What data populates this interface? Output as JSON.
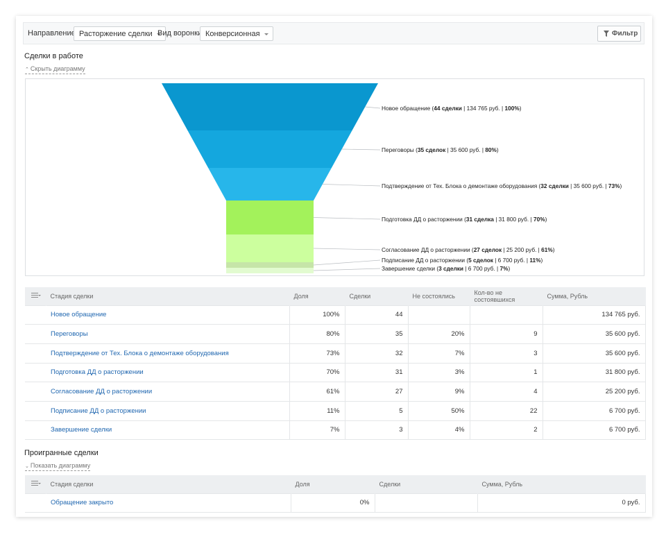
{
  "toolbar": {
    "direction_label": "Направление:",
    "direction_value": "Расторжение сделки",
    "funnel_label": "Вид воронки:",
    "funnel_value": "Конверсионная",
    "filter_label": "Фильтр"
  },
  "active": {
    "title": "Сделки в работе",
    "toggle": "Скрыть диаграмму"
  },
  "lost": {
    "title": "Проигранные сделки",
    "toggle": "Показать диаграмму"
  },
  "chart_data": {
    "type": "funnel",
    "title": "",
    "stages": [
      {
        "name": "Новое обращение",
        "deals": "44 сделки",
        "sum": "134 765 руб.",
        "percent": 100,
        "color": "#0a97cf"
      },
      {
        "name": "Переговоры",
        "deals": "35 сделок",
        "sum": "35 600 руб.",
        "percent": 80,
        "color": "#14a7de"
      },
      {
        "name": "Подтверждение от Тех. Блока о демонтаже оборудования",
        "deals": "32 сделки",
        "sum": "35 600 руб.",
        "percent": 73,
        "color": "#27b6ea"
      },
      {
        "name": "Подготовка ДД о расторжении",
        "deals": "31 сделка",
        "sum": "31 800 руб.",
        "percent": 70,
        "color": "#a3f25b"
      },
      {
        "name": "Согласование ДД о расторжении",
        "deals": "27 сделок",
        "sum": "25 200 руб.",
        "percent": 61,
        "color": "#ccff9e"
      },
      {
        "name": "Подписание ДД о расторжении",
        "deals": "5 сделок",
        "sum": "6 700 руб.",
        "percent": 11,
        "color": "#c6e5a8"
      },
      {
        "name": "Завершение сделки",
        "deals": "3 сделки",
        "sum": "6 700 руб.",
        "percent": 7,
        "color": "#e2fbd0"
      }
    ]
  },
  "table": {
    "headers": [
      "Стадия сделки",
      "Доля",
      "Сделки",
      "Не состоялись",
      "Кол-во не состоявшихся",
      "Сумма, Рубль"
    ],
    "rows": [
      {
        "stage": "Новое обращение",
        "share": "100%",
        "deals": "44",
        "failed": "",
        "failed_count": "",
        "sum": "134 765 руб."
      },
      {
        "stage": "Переговоры",
        "share": "80%",
        "deals": "35",
        "failed": "20%",
        "failed_count": "9",
        "sum": "35 600 руб."
      },
      {
        "stage": "Подтверждение от Тех. Блока о демонтаже оборудования",
        "share": "73%",
        "deals": "32",
        "failed": "7%",
        "failed_count": "3",
        "sum": "35 600 руб."
      },
      {
        "stage": "Подготовка ДД о расторжении",
        "share": "70%",
        "deals": "31",
        "failed": "3%",
        "failed_count": "1",
        "sum": "31 800 руб."
      },
      {
        "stage": "Согласование ДД о расторжении",
        "share": "61%",
        "deals": "27",
        "failed": "9%",
        "failed_count": "4",
        "sum": "25 200 руб."
      },
      {
        "stage": "Подписание ДД о расторжении",
        "share": "11%",
        "deals": "5",
        "failed": "50%",
        "failed_count": "22",
        "sum": "6 700 руб."
      },
      {
        "stage": "Завершение сделки",
        "share": "7%",
        "deals": "3",
        "failed": "4%",
        "failed_count": "2",
        "sum": "6 700 руб."
      }
    ]
  },
  "lost_table": {
    "headers": [
      "Стадия сделки",
      "Доля",
      "Сделки",
      "Сумма, Рубль"
    ],
    "rows": [
      {
        "stage": "Обращение закрыто",
        "share": "0%",
        "deals": "",
        "sum": "0 руб."
      }
    ]
  }
}
